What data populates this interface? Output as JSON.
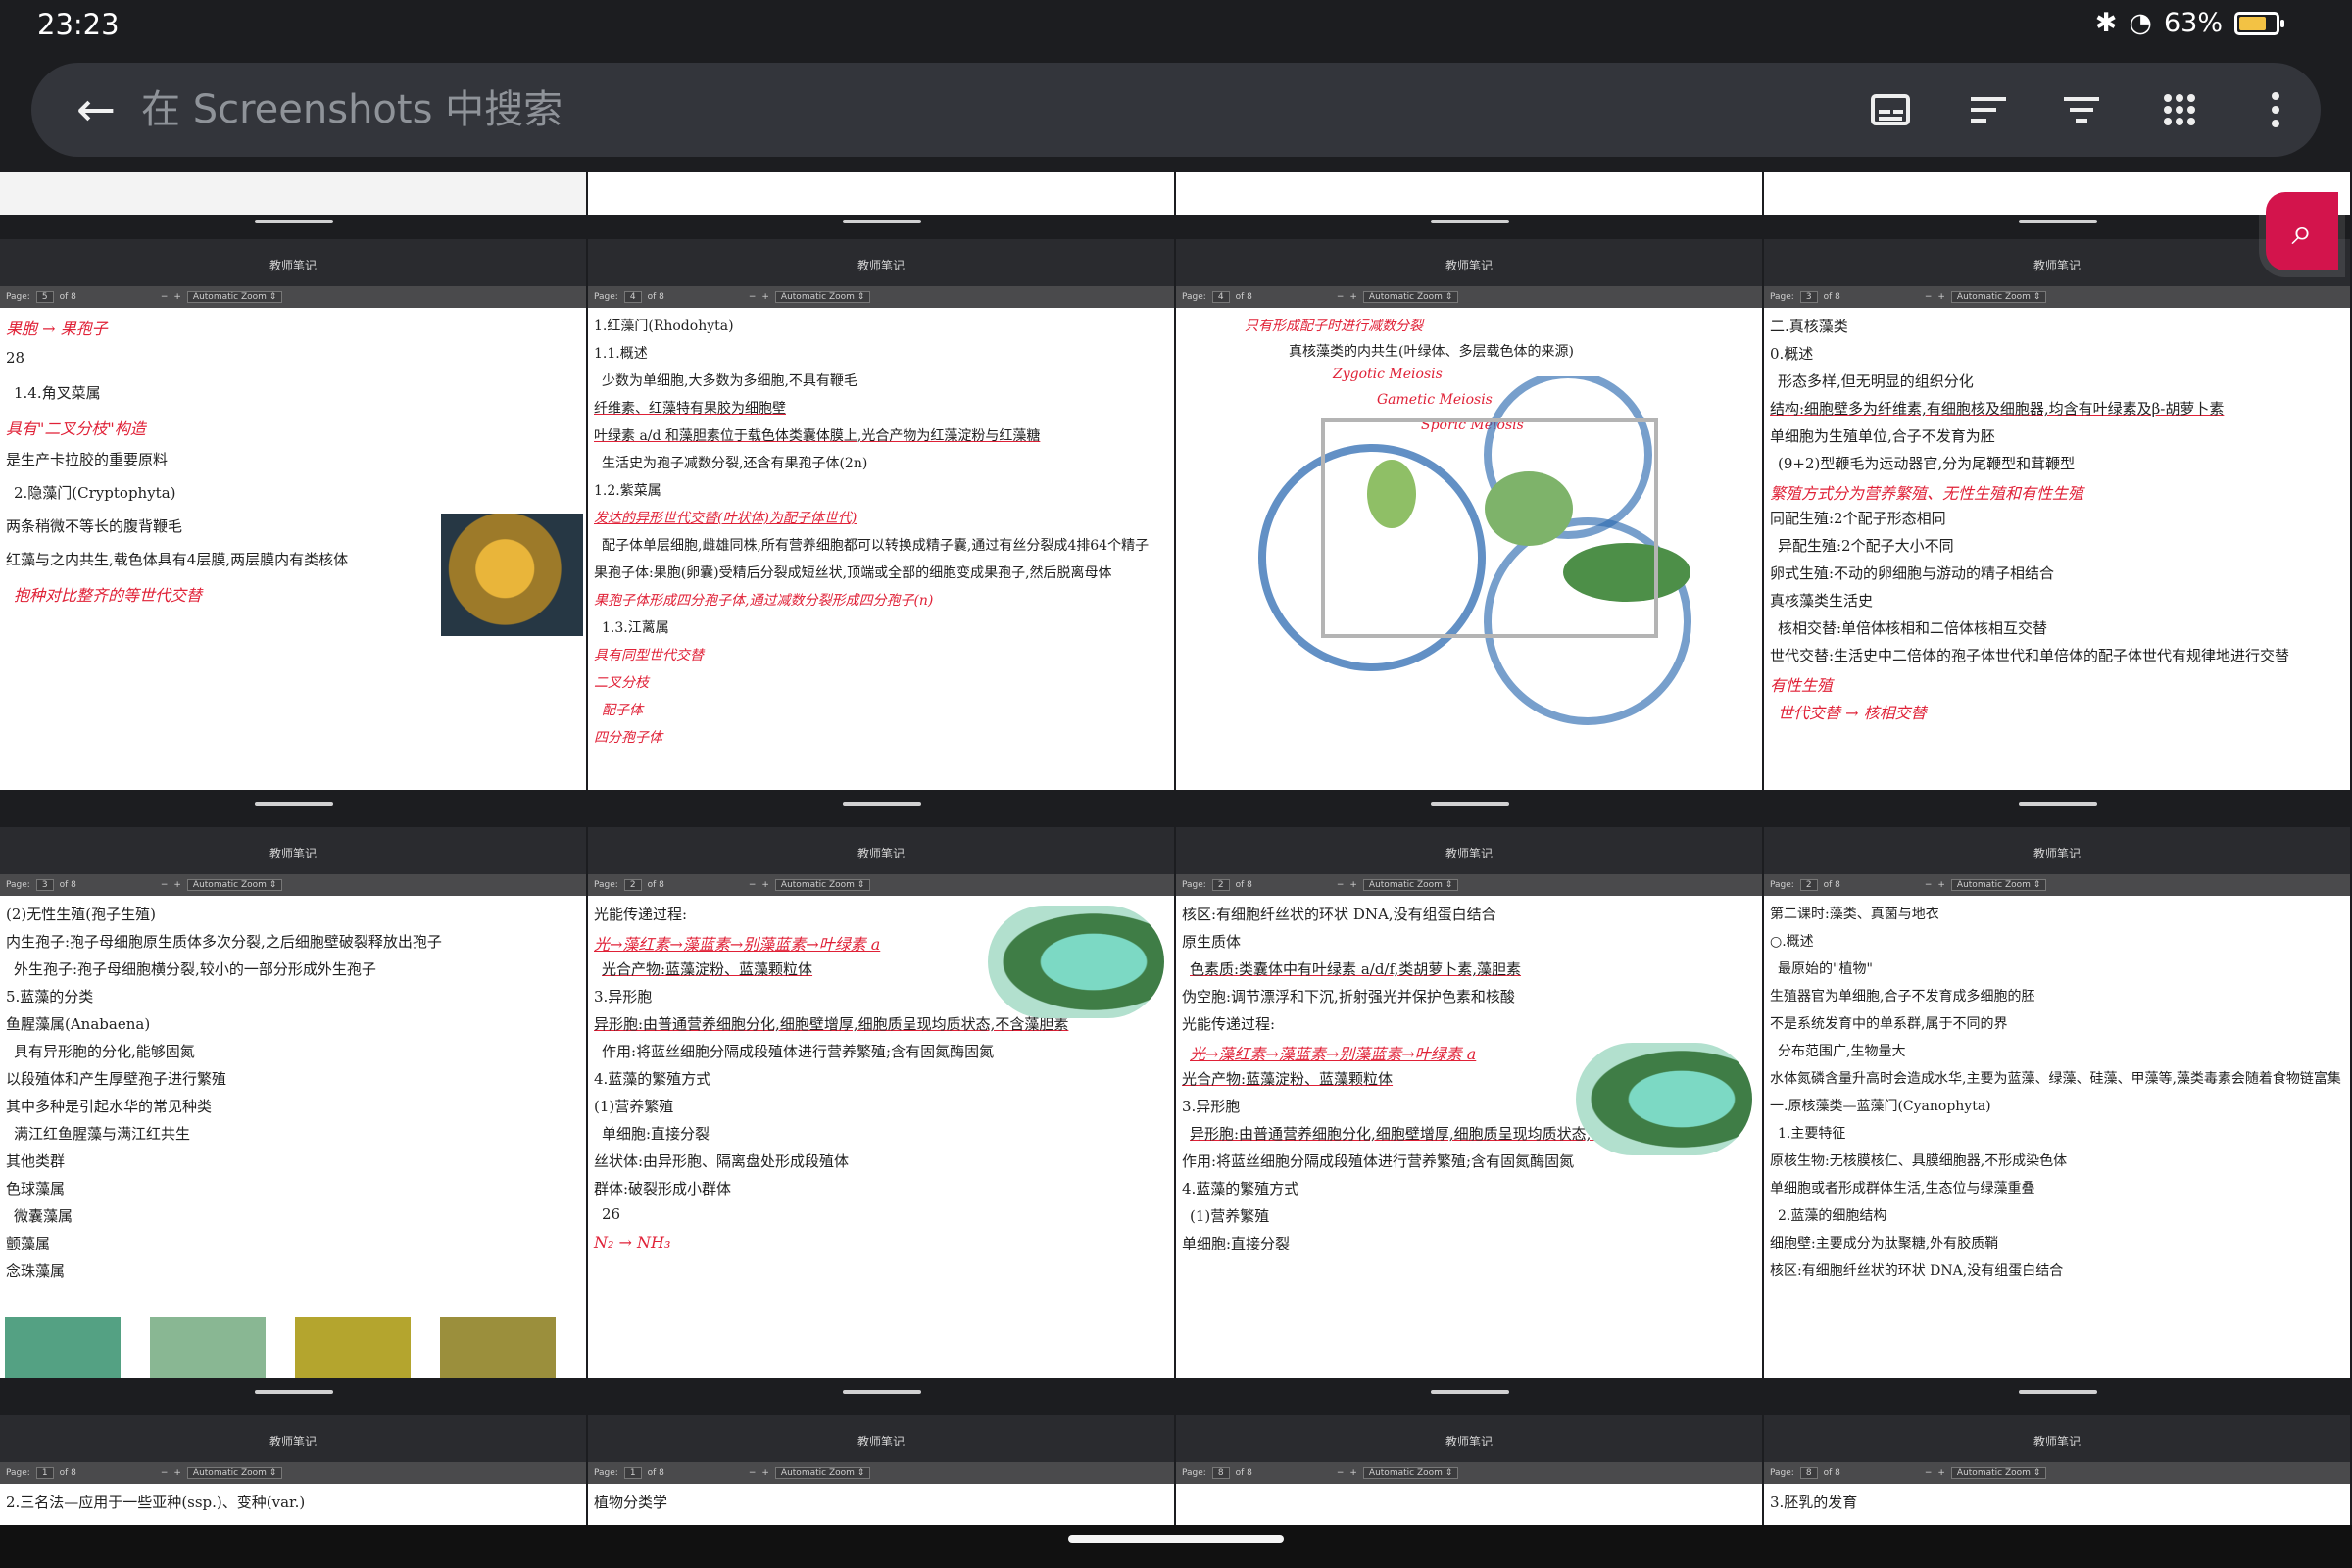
{
  "status": {
    "time": "23:23",
    "battery": "63%"
  },
  "search": {
    "placeholder": "在 Screenshots 中搜索"
  },
  "app": {
    "tile_header": "教师笔记",
    "zoom_label": "Automatic Zoom"
  },
  "icons": [
    "back-arrow-icon",
    "subtitles-icon",
    "sort-icon",
    "filter-icon",
    "grid-view-icon",
    "more-vertical-icon",
    "zoom-in-icon",
    "bluetooth-icon",
    "wifi-icon",
    "battery-icon"
  ],
  "tiles": [
    {
      "page": "5",
      "of": "of 8",
      "lines": [
        "果胞 → 果孢子",
        "28",
        "1.4.角叉菜属",
        "具有\"二叉分枝\"构造",
        "是生产卡拉胶的重要原料",
        "2.隐藻门(Cryptophyta)",
        "两条稍微不等长的腹背鞭毛",
        "红藻与之内共生,载色体具有4层膜,两层膜内有类核体",
        "抱种对比整齐的等世代交替"
      ]
    },
    {
      "page": "4",
      "of": "of 8",
      "lines": [
        "1.红藻门(Rhodohyta)",
        "1.1.概述",
        "少数为单细胞,大多数为多细胞,不具有鞭毛",
        "纤维素、红藻特有果胶为细胞壁",
        "叶绿素 a/d 和藻胆素位于载色体类囊体膜上,光合产物为红藻淀粉与红藻糖",
        "生活史为孢子减数分裂,还含有果孢子体(2n)",
        "1.2.紫菜属",
        "发达的异形世代交替(叶状体)为配子体世代)",
        "配子体单层细胞,雌雄同株,所有营养细胞都可以转换成精子囊,通过有丝分裂成4排64个精子",
        "果孢子体:果胞(卵囊)受精后分裂成短丝状,顶端或全部的细胞变成果孢子,然后脱离母体",
        "果孢子体形成四分孢子体,通过减数分裂形成四分孢子(n)",
        "1.3.江蓠属",
        "具有同型世代交替",
        "二叉分枝",
        "配子体",
        "四分孢子体"
      ]
    },
    {
      "page": "4",
      "of": "of 8",
      "lines": [
        "只有形成配子时进行减数分裂",
        "真核藻类的内共生(叶绿体、多层载色体的来源)",
        "Zygotic Meiosis",
        "Gametic Meiosis",
        "Sporic Meiosis"
      ]
    },
    {
      "page": "3",
      "of": "of 8",
      "lines": [
        "二.真核藻类",
        "0.概述",
        "形态多样,但无明显的组织分化",
        "结构:细胞壁多为纤维素,有细胞核及细胞器,均含有叶绿素及β-胡萝卜素",
        "单细胞为生殖单位,合子不发育为胚",
        "(9+2)型鞭毛为运动器官,分为尾鞭型和茸鞭型",
        "繁殖方式分为营养繁殖、无性生殖和有性生殖",
        "同配生殖:2个配子形态相同",
        "异配生殖:2个配子大小不同",
        "卵式生殖:不动的卵细胞与游动的精子相结合",
        "真核藻类生活史",
        "核相交替:单倍体核相和二倍体核相互交替",
        "世代交替:生活史中二倍体的孢子体世代和单倍体的配子体世代有规律地进行交替",
        "有性生殖",
        "世代交替 → 核相交替"
      ]
    },
    {
      "page": "3",
      "of": "of 8",
      "lines": [
        "(2)无性生殖(孢子生殖)",
        "内生孢子:孢子母细胞原生质体多次分裂,之后细胞壁破裂释放出孢子",
        "外生孢子:孢子母细胞横分裂,较小的一部分形成外生孢子",
        "5.蓝藻的分类",
        "鱼腥藻属(Anabaena)",
        "具有异形胞的分化,能够固氮",
        "以段殖体和产生厚壁孢子进行繁殖",
        "其中多种是引起水华的常见种类",
        "满江红鱼腥藻与满江红共生",
        "其他类群",
        "色球藻属",
        "微囊藻属",
        "颤藻属",
        "念珠藻属"
      ]
    },
    {
      "page": "2",
      "of": "of 8",
      "lines": [
        "光能传递过程:",
        "光→藻红素→藻蓝素→别藻蓝素→叶绿素 a",
        "光合产物:蓝藻淀粉、蓝藻颗粒体",
        "3.异形胞",
        "异形胞:由普通营养细胞分化,细胞壁增厚,细胞质呈现均质状态,不含藻胆素",
        "作用:将蓝丝细胞分隔成段殖体进行营养繁殖;含有固氮酶固氮",
        "4.蓝藻的繁殖方式",
        "(1)营养繁殖",
        "单细胞:直接分裂",
        "丝状体:由异形胞、隔离盘处形成段殖体",
        "群体:破裂形成小群体",
        "26",
        "N₂ → NH₃"
      ]
    },
    {
      "page": "2",
      "of": "of 8",
      "lines": [
        "核区:有细胞纤丝状的环状 DNA,没有组蛋白结合",
        "原生质体",
        "色素质:类囊体中有叶绿素 a/d/f,类胡萝卜素,藻胆素",
        "伪空胞:调节漂浮和下沉,折射强光并保护色素和核酸",
        "光能传递过程:",
        "光→藻红素→藻蓝素→别藻蓝素→叶绿素 a",
        "光合产物:蓝藻淀粉、蓝藻颗粒体",
        "3.异形胞",
        "异形胞:由普通营养细胞分化,细胞壁增厚,细胞质呈现均质状态,不含藻胆素",
        "作用:将蓝丝细胞分隔成段殖体进行营养繁殖;含有固氮酶固氮",
        "4.蓝藻的繁殖方式",
        "(1)营养繁殖",
        "单细胞:直接分裂"
      ]
    },
    {
      "page": "2",
      "of": "of 8",
      "lines": [
        "第二课时:藻类、真菌与地衣",
        "○.概述",
        "最原始的\"植物\"",
        "生殖器官为单细胞,合子不发育成多细胞的胚",
        "不是系统发育中的单系群,属于不同的界",
        "分布范围广,生物量大",
        "水体氮磷含量升高时会造成水华,主要为蓝藻、绿藻、硅藻、甲藻等,藻类毒素会随着食物链富集",
        "一.原核藻类—蓝藻门(Cyanophyta)",
        "1.主要特征",
        "原核生物:无核膜核仁、具膜细胞器,不形成染色体",
        "单细胞或者形成群体生活,生态位与绿藻重叠",
        "2.蓝藻的细胞结构",
        "细胞壁:主要成分为肽聚糖,外有胶质鞘",
        "核区:有细胞纤丝状的环状 DNA,没有组蛋白结合"
      ]
    },
    {
      "page": "1",
      "of": "of 8",
      "lines": [
        "2.三名法—应用于一些亚种(ssp.)、变种(var.)"
      ]
    },
    {
      "page": "1",
      "of": "of 8",
      "lines": [
        "植物分类学"
      ]
    },
    {
      "page": "8",
      "of": "of 8",
      "lines": []
    },
    {
      "page": "8",
      "of": "of 8",
      "lines": [
        "3.胚乳的发育"
      ]
    }
  ]
}
